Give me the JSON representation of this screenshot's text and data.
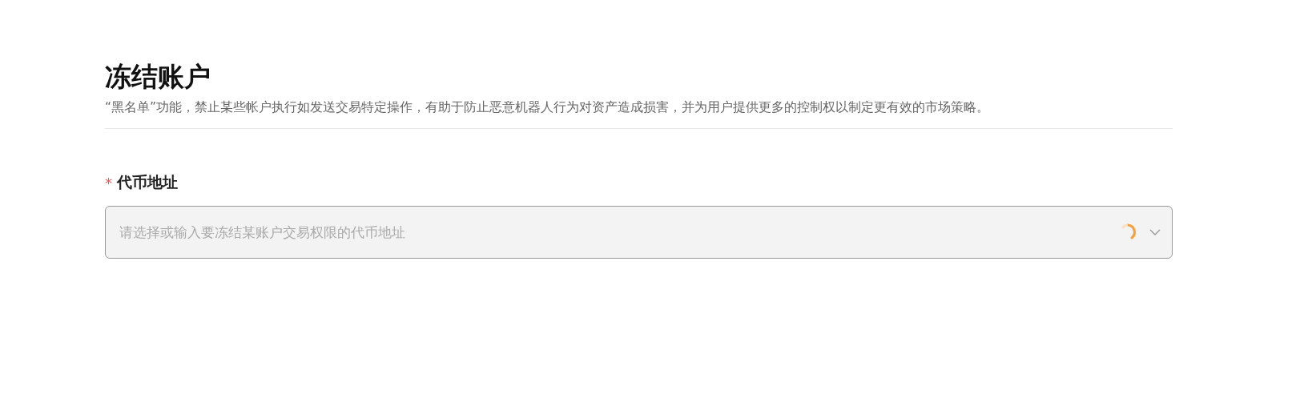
{
  "page": {
    "title": "冻结账户",
    "description": "“黑名单”功能，禁止某些帐户执行如发送交易特定操作，有助于防止恶意机器人行为对资产造成损害，并为用户提供更多的控制权以制定更有效的市场策略。"
  },
  "form": {
    "field": {
      "label": "代币地址",
      "required": true,
      "required_mark": "*",
      "placeholder": "请选择或输入要冻结某账户交易权限的代币地址",
      "loading": true
    }
  }
}
